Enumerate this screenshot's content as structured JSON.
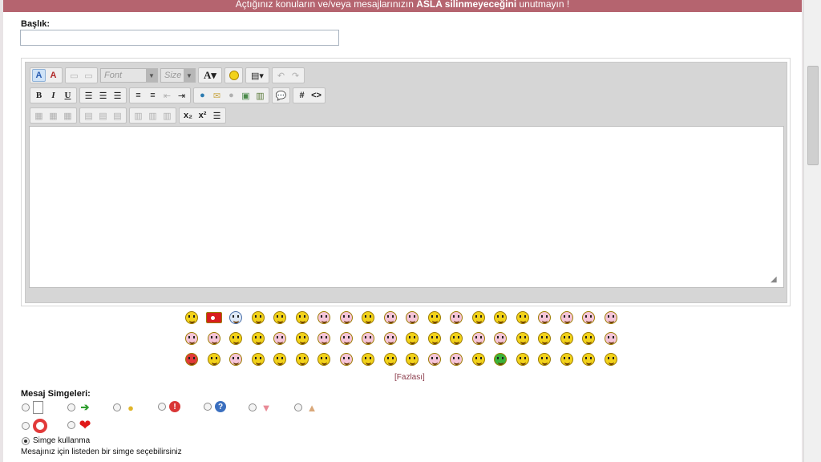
{
  "banner": {
    "prefix": "Açtığınız konuların ve/veya mesajlarınızın ",
    "emphasis": "ASLA silinmeyeceğini",
    "suffix": " unutmayın !"
  },
  "form": {
    "title_label": "Başlık:",
    "title_value": "",
    "title_placeholder": ""
  },
  "toolbar": {
    "row1": {
      "font_combo": "Font",
      "size_combo": "Size",
      "text_color_label": "A"
    },
    "row2": {
      "bold": "B",
      "italic": "I",
      "underline": "U",
      "hash": "#",
      "code": "<>"
    },
    "row3": {
      "subscript": "x₂",
      "superscript": "x²"
    }
  },
  "editor": {
    "content": ""
  },
  "smilies": {
    "rows": [
      [
        "smiley-signs",
        "smiley-turkey-flag",
        "smiley-eye",
        "smiley-hands",
        "smiley-hat",
        "smiley-sad",
        "smiley-pink-shout",
        "smiley-pink-wave",
        "smiley-clap",
        "smiley-pink-lipstick",
        "smiley-pink-angry",
        "smiley-mask",
        "smiley-pink-laugh",
        "smiley-sleep",
        "smiley-wave",
        "smiley-glasses",
        "smiley-pink-tongue",
        "smiley-pink-cry",
        "smiley-pink-happy",
        "smiley-pink-grin"
      ],
      [
        "smiley-pink-kiss",
        "smiley-pink-dance",
        "smiley-shy",
        "smiley-wink",
        "smiley-pink-cool",
        "smiley-whistle",
        "smiley-pink-star",
        "smiley-pink-hug",
        "smiley-pink-blush",
        "smiley-pink-love",
        "smiley-crazy",
        "smiley-yawn",
        "smiley-eyes",
        "smiley-pink-shock",
        "smiley-pink-sing",
        "smiley-think",
        "smiley-bigeyes",
        "smiley-grin",
        "smiley-small",
        "smiley-pink-flirt"
      ],
      [
        "smiley-devil-red",
        "smiley-blink",
        "smiley-pink-bye",
        "smiley-nerd",
        "smiley-sleepy",
        "smiley-magnify",
        "smiley-ill",
        "smiley-pink-party",
        "smiley-look",
        "smiley-cry",
        "smiley-devil",
        "smiley-pink-rabbit",
        "smiley-pink-banana",
        "smiley-neutral",
        "smiley-green",
        "smiley-monkey",
        "smiley-surprise",
        "smiley-lips",
        "smiley-tired",
        "smiley-chef"
      ]
    ],
    "more_link": "[Fazlası]"
  },
  "message_icons": {
    "label": "Mesaj Simgeleri:",
    "options": [
      {
        "icon": "document-icon",
        "checked": false
      },
      {
        "icon": "arrow-icon",
        "checked": false
      },
      {
        "icon": "lightbulb-icon",
        "checked": false
      },
      {
        "icon": "exclamation-icon",
        "checked": false
      },
      {
        "icon": "question-icon",
        "checked": false
      },
      {
        "icon": "thumbs-down-icon",
        "checked": false
      },
      {
        "icon": "thumbs-up-icon",
        "checked": false
      },
      {
        "icon": "lifebuoy-icon",
        "checked": false
      },
      {
        "icon": "heart-icon",
        "checked": false
      }
    ],
    "no_icon_label": "Simge kullanma",
    "no_icon_checked": true,
    "hint": "Mesajınız için listeden bir simge seçebilirsiniz"
  },
  "colors": {
    "banner_bg": "#b5646f",
    "link": "#8a3a4a"
  }
}
